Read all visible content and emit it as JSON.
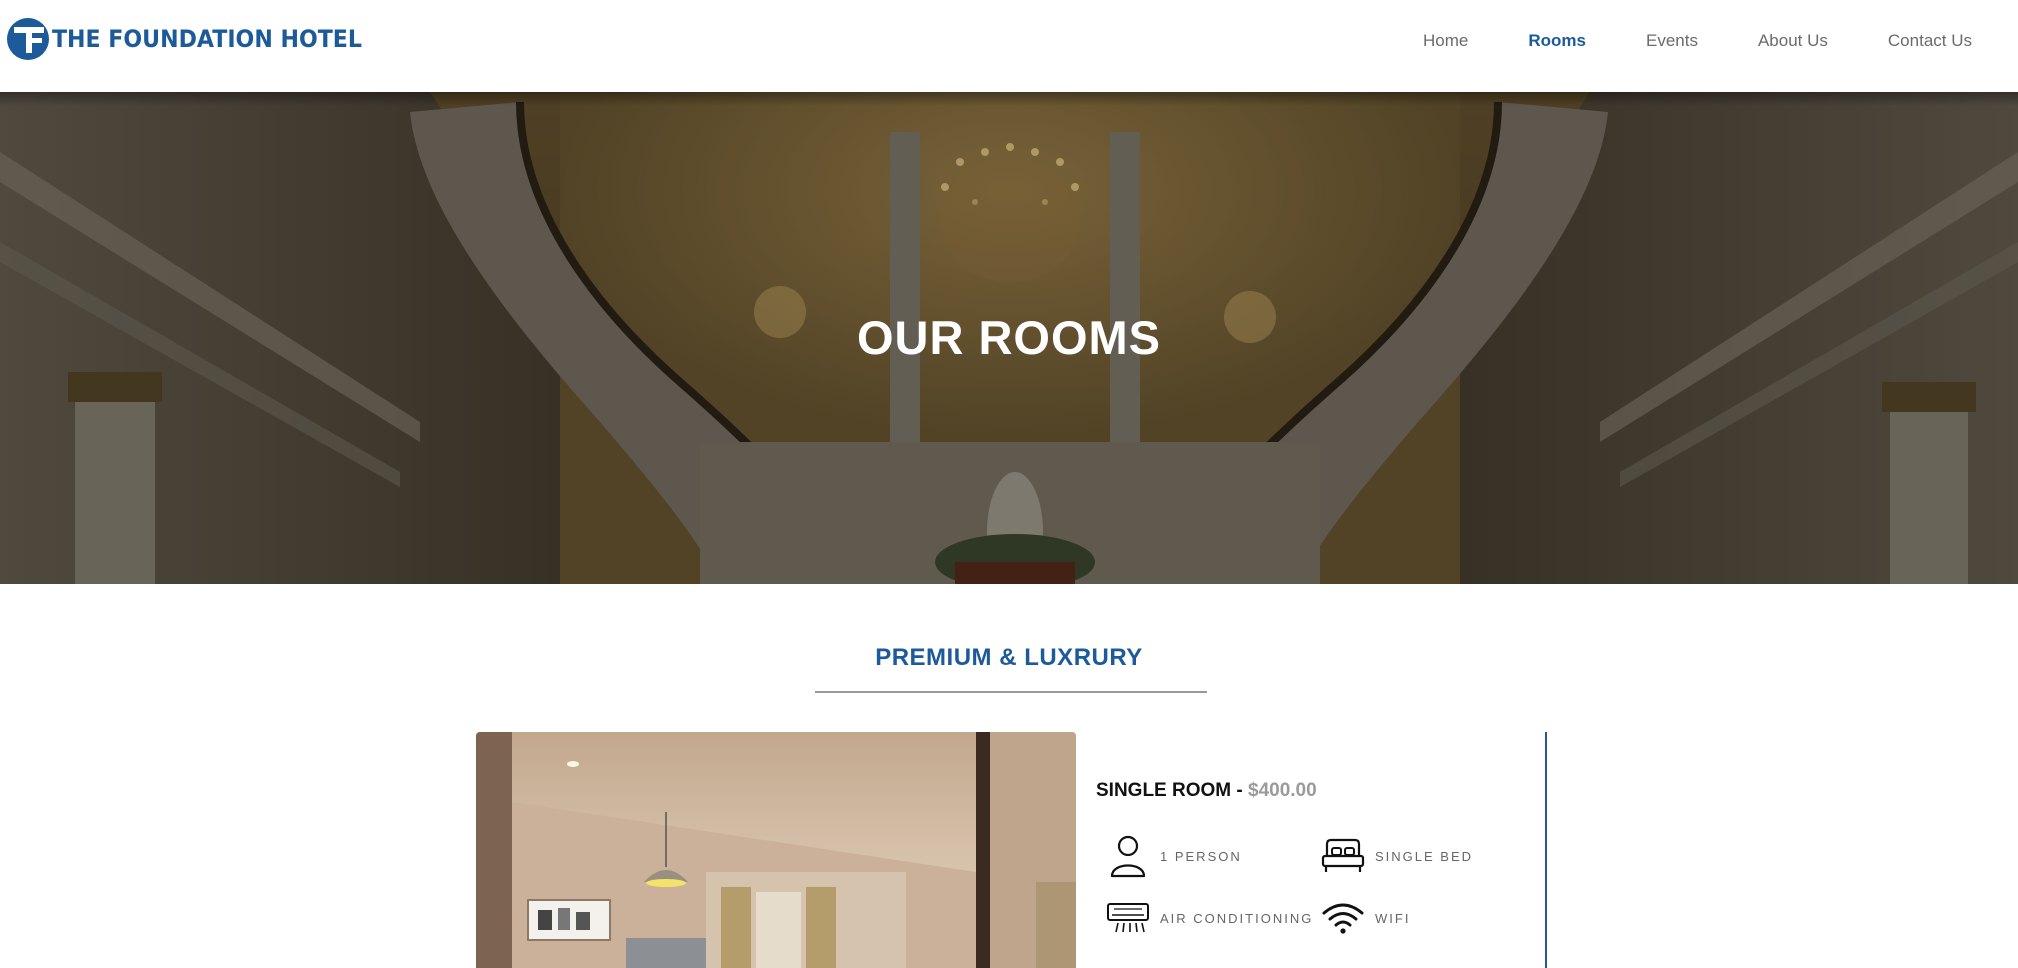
{
  "brand": {
    "name": "THE FOUNDATION HOTEL",
    "color": "#1d5a9a"
  },
  "nav": {
    "items": [
      {
        "label": "Home",
        "active": false
      },
      {
        "label": "Rooms",
        "active": true
      },
      {
        "label": "Events",
        "active": false
      },
      {
        "label": "About Us",
        "active": false
      },
      {
        "label": "Contact Us",
        "active": false
      }
    ]
  },
  "hero": {
    "title": "OUR ROOMS",
    "image": "grand-staircase-chandelier-photo"
  },
  "section": {
    "title": "PREMIUM & LUXRURY"
  },
  "room": {
    "name": "SINGLE ROOM -",
    "price": "$400.00",
    "image": "single-room-interior-photo",
    "amenities": [
      {
        "icon": "person-icon",
        "label": "1 PERSON"
      },
      {
        "icon": "bed-icon",
        "label": "SINGLE BED"
      },
      {
        "icon": "air-conditioner-icon",
        "label": "AIR CONDITIONING"
      },
      {
        "icon": "wifi-icon",
        "label": "WIFI"
      }
    ]
  },
  "colors": {
    "accent": "#1d5a9a",
    "muted_text": "#6b6b6b",
    "price": "#9a9a9a"
  }
}
